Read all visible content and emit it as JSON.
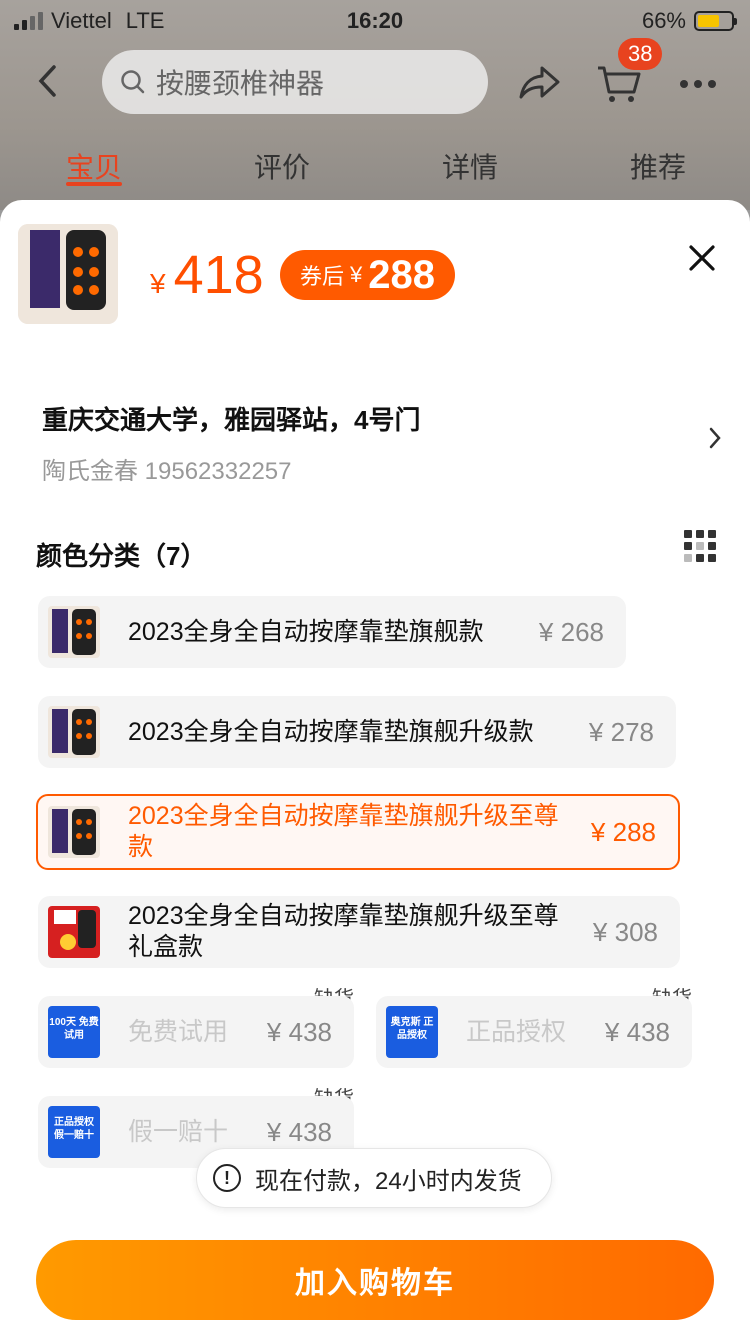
{
  "status": {
    "carrier": "Viettel",
    "network": "LTE",
    "time": "16:20",
    "battery": "66%",
    "battery_level": 0.66
  },
  "nav": {
    "search_placeholder": "按腰颈椎神器",
    "cart_count": "38"
  },
  "tabs": [
    {
      "label": "宝贝",
      "active": true
    },
    {
      "label": "评价",
      "active": false
    },
    {
      "label": "详情",
      "active": false
    },
    {
      "label": "推荐",
      "active": false
    }
  ],
  "product": {
    "currency": "¥",
    "price": "418",
    "coupon_label": "券后",
    "coupon_price": "288"
  },
  "address": {
    "line": "重庆交通大学，雅园驿站，4号门",
    "contact": "陶氏金春 19562332257"
  },
  "sku_section": {
    "title": "颜色分类（7）"
  },
  "skus": [
    {
      "name": "2023全身全自动按摩靠垫旗舰款",
      "price": "¥ 268"
    },
    {
      "name": "2023全身全自动按摩靠垫旗舰升级款",
      "price": "¥ 278"
    },
    {
      "name": "2023全身全自动按摩靠垫旗舰升级至尊款",
      "price": "¥ 288",
      "selected": true
    },
    {
      "name": "2023全身全自动按摩靠垫旗舰升级至尊礼盒款",
      "price": "¥ 308"
    },
    {
      "name": "免费试用",
      "price": "¥ 438",
      "tag": "缺货",
      "icon_text": "100天 免费试用"
    },
    {
      "name": "正品授权",
      "price": "¥ 438",
      "tag": "缺货",
      "icon_text": "奥克斯 正品授权"
    },
    {
      "name": "假一赔十",
      "price": "¥ 438",
      "tag": "缺货",
      "icon_text": "正品授权 假一赔十"
    }
  ],
  "notice": "现在付款，24小时内发货",
  "cta": "加入购物车",
  "colors": {
    "accent": "#ff5a00",
    "cta_start": "#ff9a00",
    "cta_end": "#ff6a00",
    "blue_icon": "#1a5de0"
  }
}
